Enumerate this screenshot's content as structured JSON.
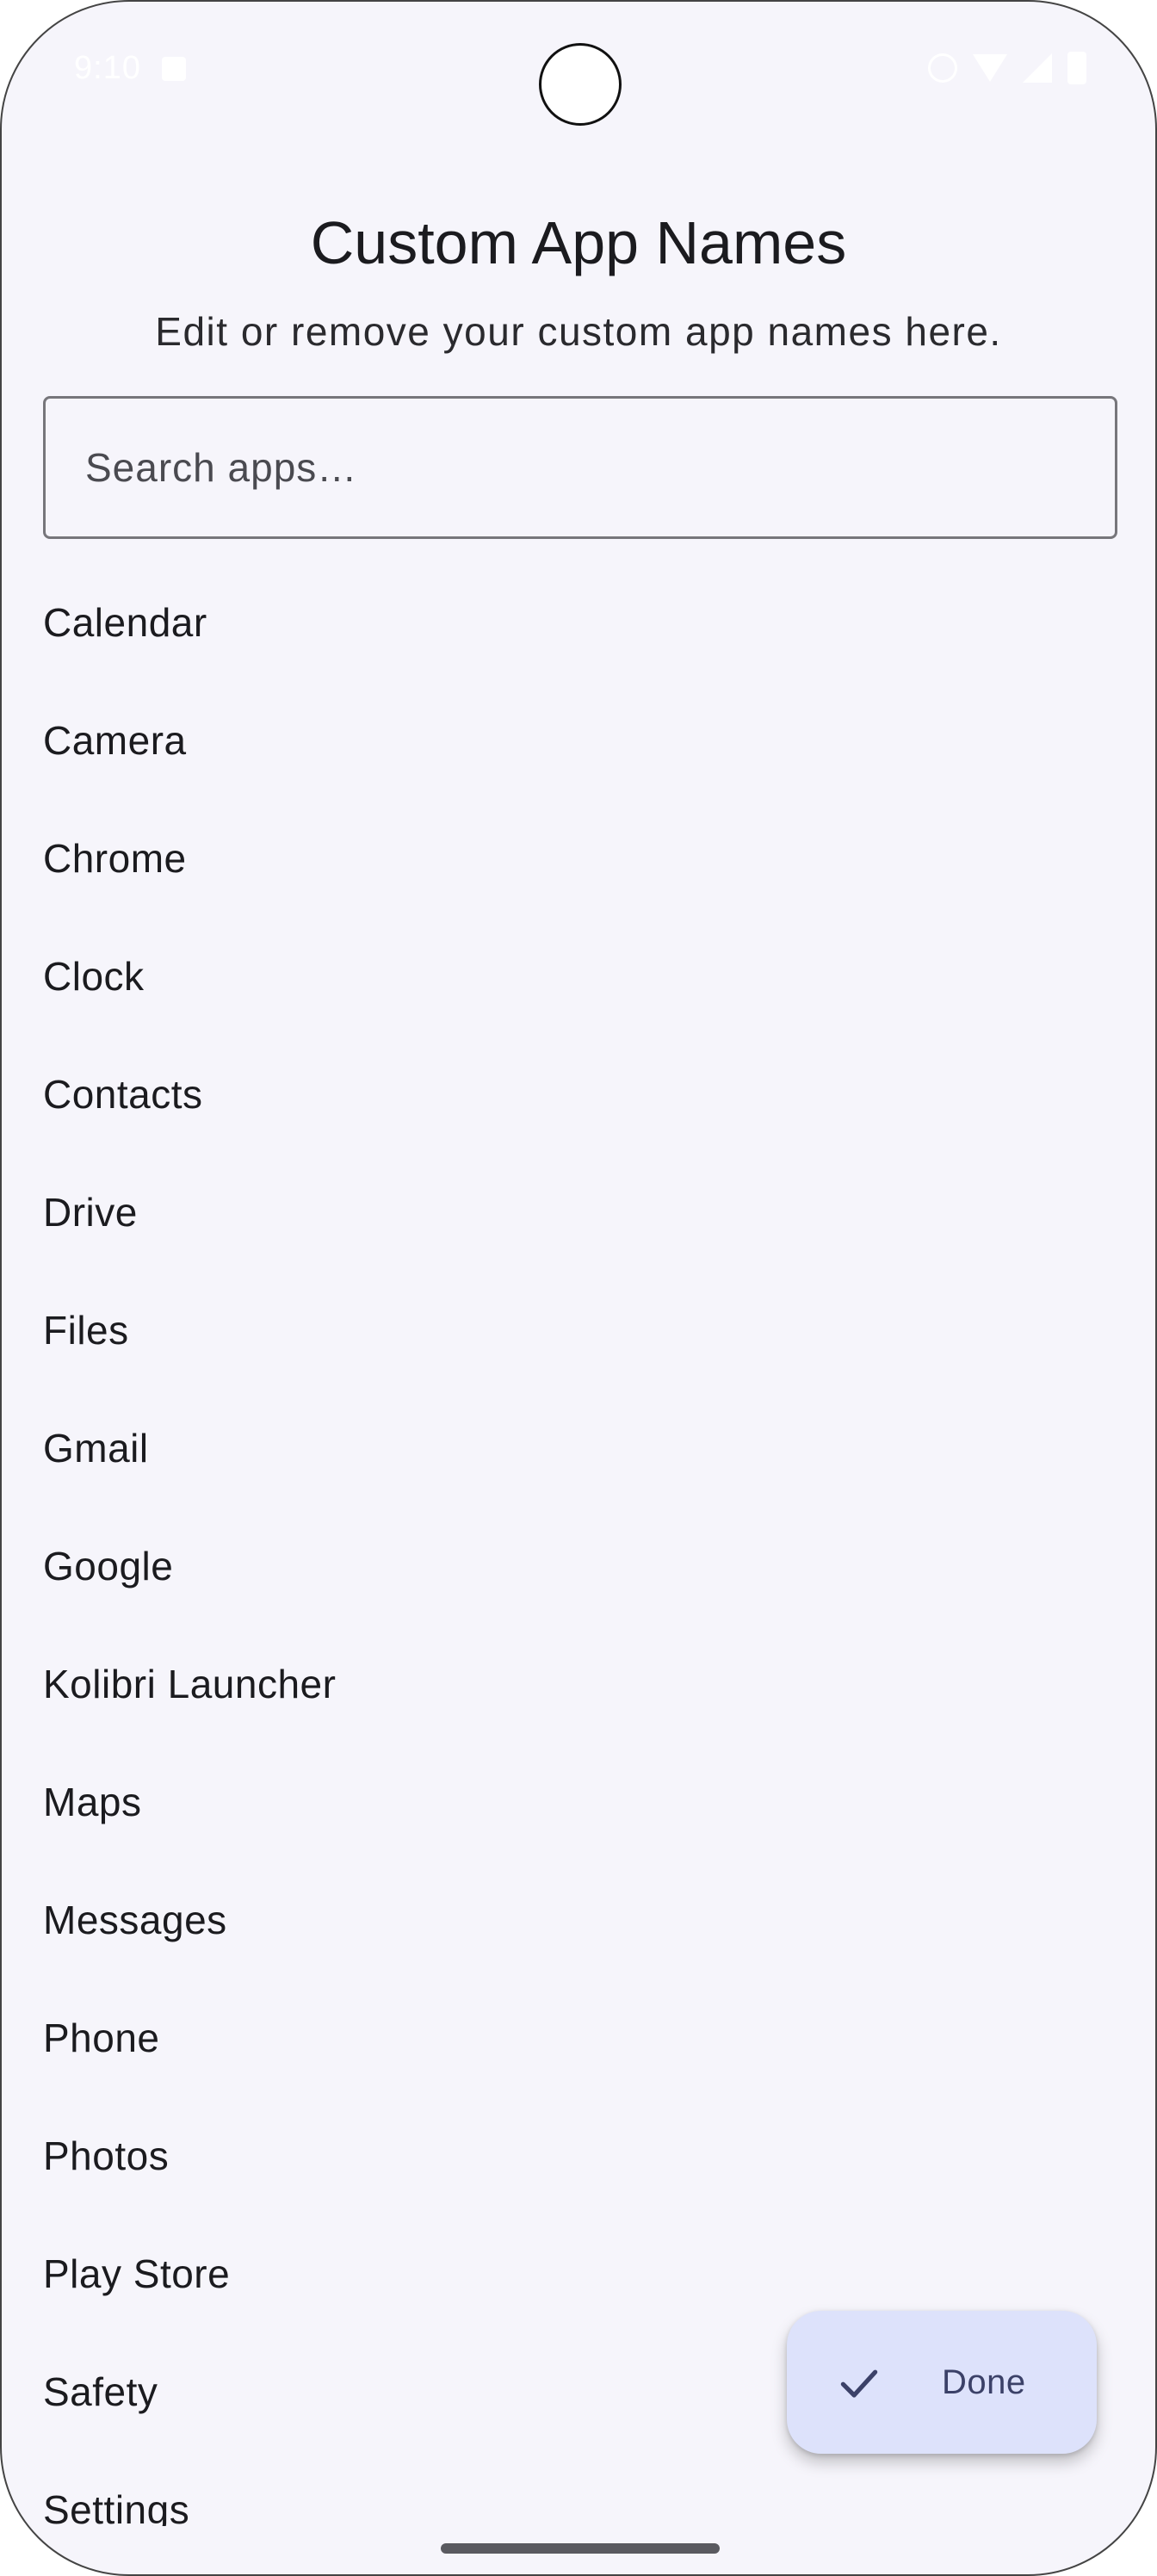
{
  "status_bar": {
    "time": "9:10"
  },
  "header": {
    "title": "Custom App Names",
    "subtitle": "Edit or remove your custom app names here."
  },
  "search": {
    "placeholder": "Search apps…",
    "value": ""
  },
  "apps": [
    "Calendar",
    "Camera",
    "Chrome",
    "Clock",
    "Contacts",
    "Drive",
    "Files",
    "Gmail",
    "Google",
    "Kolibri Launcher",
    "Maps",
    "Messages",
    "Phone",
    "Photos",
    "Play Store",
    "Safety",
    "Settings"
  ],
  "fab": {
    "label": "Done",
    "icon": "check-icon"
  },
  "colors": {
    "background": "#f6f5fb",
    "fab_background": "#dde2fb",
    "fab_text": "#3b4168"
  }
}
